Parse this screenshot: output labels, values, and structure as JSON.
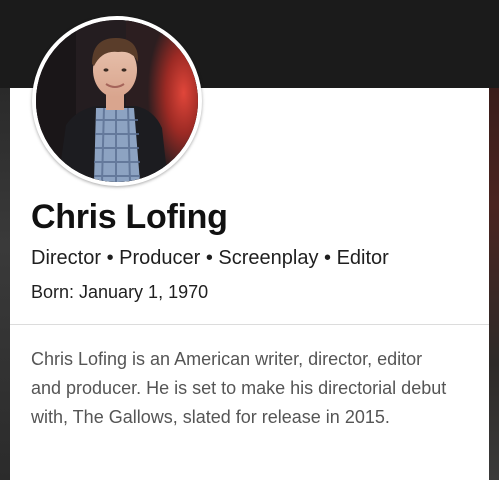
{
  "profile": {
    "name": "Chris Lofing",
    "roles": "Director • Producer • Screenplay • Editor",
    "born": "Born: January 1, 1970",
    "bio": "Chris Lofing is an American writer, director, editor and producer. He is set to make his directorial debut with, The Gallows, slated for release in 2015."
  },
  "colors": {
    "header_background": "#1b1b1b",
    "card_background": "#ffffff",
    "name_text": "#111111",
    "bio_text": "#555555"
  }
}
